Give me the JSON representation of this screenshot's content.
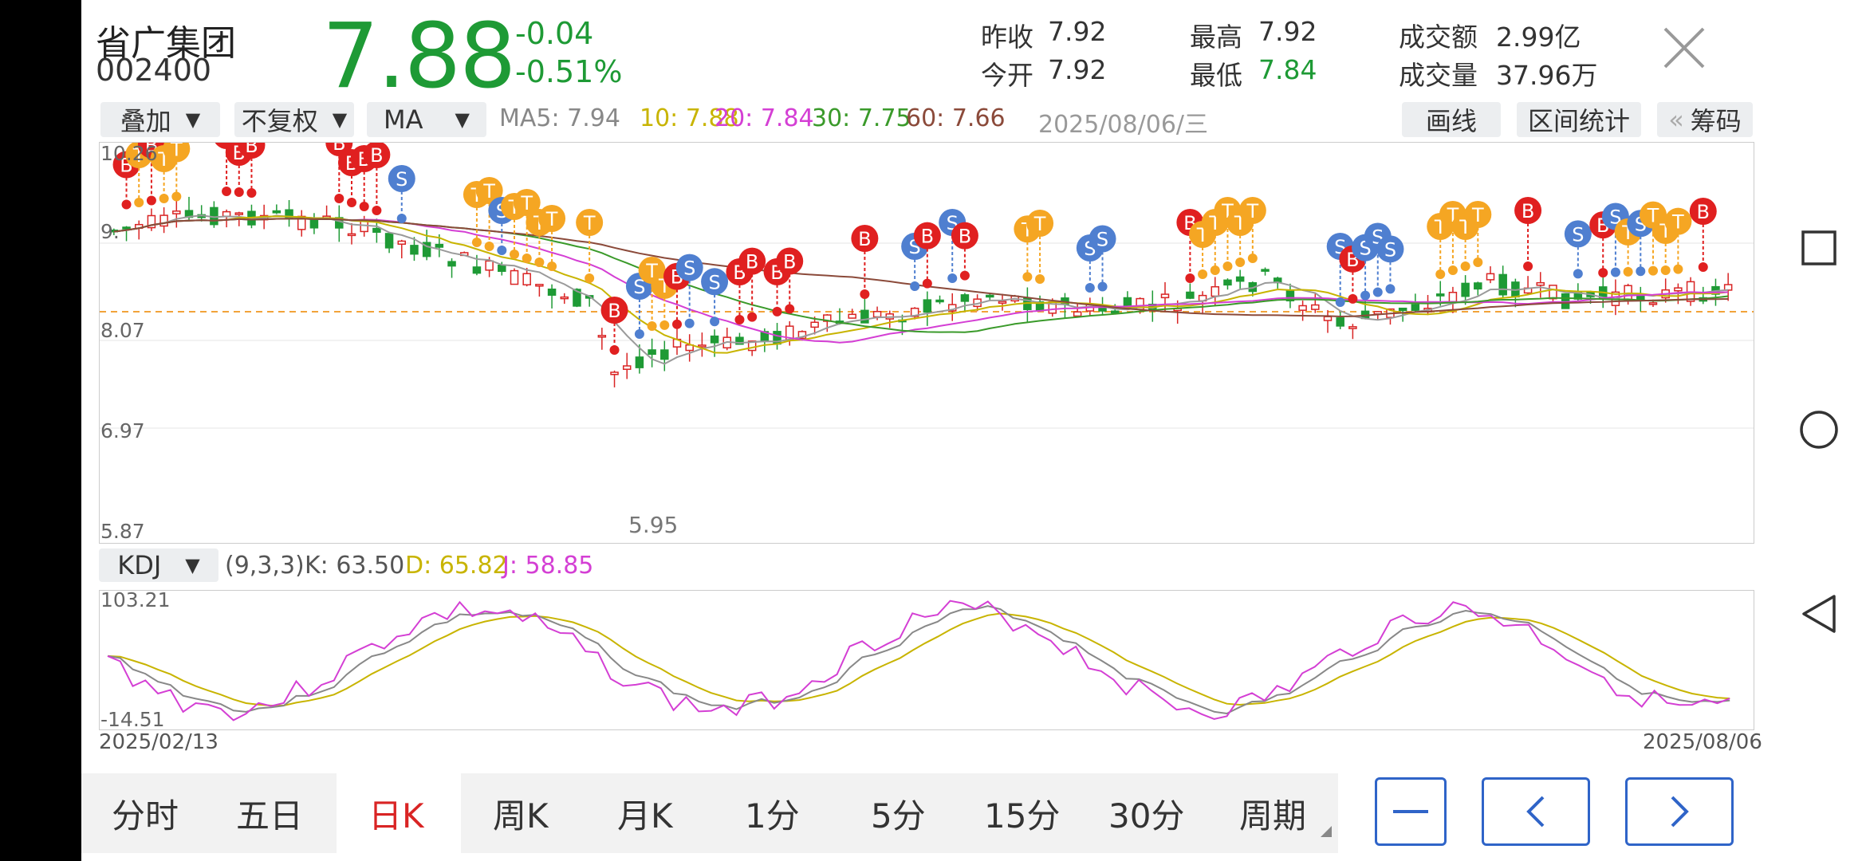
{
  "stock": {
    "name": "省广集团",
    "code": "002400",
    "price": "7.88",
    "change": "-0.04",
    "change_pct": "-0.51%"
  },
  "stats": {
    "prev_close_label": "昨收",
    "prev_close": "7.92",
    "open_label": "今开",
    "open": "7.92",
    "high_label": "最高",
    "high": "7.92",
    "low_label": "最低",
    "low": "7.84",
    "amount_label": "成交额",
    "amount": "2.99亿",
    "volume_label": "成交量",
    "volume": "37.96万"
  },
  "toolbar": {
    "overlay": "叠加",
    "adjust": "不复权",
    "indicator": "MA",
    "ma5": "MA5: 7.94",
    "ma10": "10: 7.88",
    "ma20": "20: 7.84",
    "ma30": "30: 7.75",
    "ma60": "60: 7.66",
    "date": "2025/08/06/三",
    "draw": "画线",
    "range_stats": "区间统计",
    "chips_arrow": "«",
    "chips": "筹码"
  },
  "colors": {
    "up": "#d92424",
    "down": "#1e9a35",
    "ma5": "#9a9a9a",
    "ma10": "#c8b400",
    "ma20": "#d43fd4",
    "ma30": "#3a9a2a",
    "ma60": "#8b4a3a",
    "marker_b": "#e02020",
    "marker_s": "#4f7fd0",
    "marker_t": "#f5a623"
  },
  "kline": {
    "y_labels": [
      "10.26",
      "9.",
      "8.07",
      "6.97",
      "5.87"
    ],
    "low_annotation": "5.95",
    "markers": [
      {
        "t": "B",
        "i": 1
      },
      {
        "t": "T",
        "i": 2
      },
      {
        "t": "B",
        "i": 3
      },
      {
        "t": "T",
        "i": 4
      },
      {
        "t": "T",
        "i": 5
      },
      {
        "t": "B",
        "i": 9
      },
      {
        "t": "B",
        "i": 10
      },
      {
        "t": "B",
        "i": 11
      },
      {
        "t": "B",
        "i": 18
      },
      {
        "t": "B",
        "i": 19
      },
      {
        "t": "B",
        "i": 20
      },
      {
        "t": "B",
        "i": 21
      },
      {
        "t": "S",
        "i": 23
      },
      {
        "t": "T",
        "i": 29
      },
      {
        "t": "T",
        "i": 30
      },
      {
        "t": "S",
        "i": 31
      },
      {
        "t": "T",
        "i": 32
      },
      {
        "t": "T",
        "i": 33
      },
      {
        "t": "T",
        "i": 34
      },
      {
        "t": "T",
        "i": 35
      },
      {
        "t": "T",
        "i": 38
      },
      {
        "t": "B",
        "i": 40
      },
      {
        "t": "S",
        "i": 42
      },
      {
        "t": "T",
        "i": 43
      },
      {
        "t": "T",
        "i": 44
      },
      {
        "t": "B",
        "i": 45
      },
      {
        "t": "S",
        "i": 46
      },
      {
        "t": "S",
        "i": 48
      },
      {
        "t": "B",
        "i": 50
      },
      {
        "t": "B",
        "i": 51
      },
      {
        "t": "B",
        "i": 53
      },
      {
        "t": "B",
        "i": 54
      },
      {
        "t": "B",
        "i": 60
      },
      {
        "t": "S",
        "i": 64
      },
      {
        "t": "B",
        "i": 65
      },
      {
        "t": "S",
        "i": 67
      },
      {
        "t": "B",
        "i": 68
      },
      {
        "t": "T",
        "i": 73
      },
      {
        "t": "T",
        "i": 74
      },
      {
        "t": "S",
        "i": 78
      },
      {
        "t": "S",
        "i": 79
      },
      {
        "t": "B",
        "i": 86
      },
      {
        "t": "T",
        "i": 87
      },
      {
        "t": "T",
        "i": 88
      },
      {
        "t": "T",
        "i": 89
      },
      {
        "t": "T",
        "i": 90
      },
      {
        "t": "T",
        "i": 91
      },
      {
        "t": "S",
        "i": 98
      },
      {
        "t": "B",
        "i": 99
      },
      {
        "t": "S",
        "i": 100
      },
      {
        "t": "S",
        "i": 101
      },
      {
        "t": "S",
        "i": 102
      },
      {
        "t": "T",
        "i": 106
      },
      {
        "t": "T",
        "i": 107
      },
      {
        "t": "T",
        "i": 108
      },
      {
        "t": "T",
        "i": 109
      },
      {
        "t": "B",
        "i": 113
      },
      {
        "t": "S",
        "i": 117
      },
      {
        "t": "B",
        "i": 119
      },
      {
        "t": "S",
        "i": 120
      },
      {
        "t": "T",
        "i": 121
      },
      {
        "t": "S",
        "i": 122
      },
      {
        "t": "T",
        "i": 123
      },
      {
        "t": "T",
        "i": 124
      },
      {
        "t": "T",
        "i": 125
      },
      {
        "t": "B",
        "i": 127
      }
    ]
  },
  "kdj": {
    "indicator": "KDJ",
    "params": "(9,3,3)",
    "k": "K: 63.50",
    "d": "D: 65.82",
    "j": "J: 58.85",
    "y_top": "103.21",
    "y_bottom": "-14.51"
  },
  "dates": {
    "start": "2025/02/13",
    "end": "2025/08/06"
  },
  "periods": [
    "分时",
    "五日",
    "日K",
    "周K",
    "月K",
    "1分",
    "5分",
    "15分",
    "30分",
    "周期"
  ],
  "active_period": "日K",
  "nav_buttons": {
    "minus": "—",
    "prev": "‹",
    "next": "›"
  }
}
